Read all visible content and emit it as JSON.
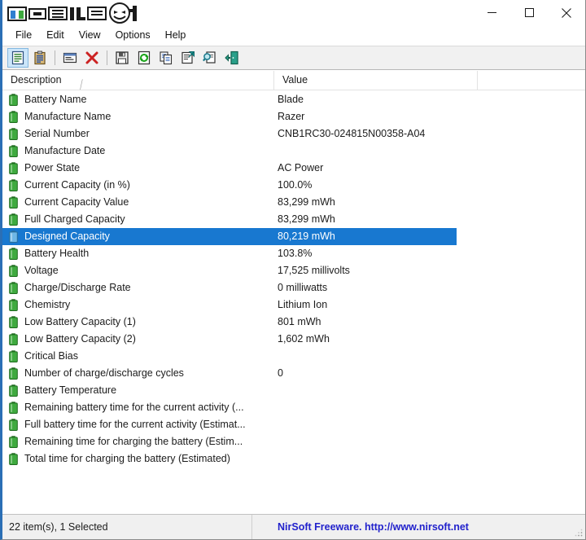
{
  "window": {
    "logo_alt": "mobile01",
    "controls": [
      {
        "name": "minimize",
        "glyph": "—"
      },
      {
        "name": "maximize",
        "glyph": "□"
      },
      {
        "name": "close",
        "glyph": "✕"
      }
    ]
  },
  "menu": {
    "items": [
      {
        "label": "File"
      },
      {
        "label": "Edit"
      },
      {
        "label": "View"
      },
      {
        "label": "Options"
      },
      {
        "label": "Help"
      }
    ]
  },
  "toolbar": {
    "buttons": [
      {
        "icon": "properties-icon",
        "pressed": true
      },
      {
        "icon": "clipboard-icon",
        "pressed": false
      },
      {
        "sep": true
      },
      {
        "icon": "html-report-icon",
        "pressed": false
      },
      {
        "icon": "delete-red-x-icon",
        "pressed": false
      },
      {
        "sep": true
      },
      {
        "icon": "save-floppy-icon",
        "pressed": false
      },
      {
        "icon": "refresh-icon",
        "pressed": false
      },
      {
        "icon": "copy-icon",
        "pressed": false
      },
      {
        "icon": "properties-page-icon",
        "pressed": false
      },
      {
        "icon": "find-icon",
        "pressed": false
      },
      {
        "icon": "exit-icon",
        "pressed": false
      }
    ]
  },
  "list": {
    "columns": [
      {
        "key": "description",
        "label": "Description",
        "sorted": true,
        "sort_glyph": "╱"
      },
      {
        "key": "value",
        "label": "Value",
        "sorted": false
      }
    ],
    "row_icon": "battery-icon",
    "rows": [
      {
        "description": "Battery Name",
        "value": "Blade",
        "selected": false
      },
      {
        "description": "Manufacture Name",
        "value": "Razer",
        "selected": false
      },
      {
        "description": "Serial Number",
        "value": "CNB1RC30-024815N00358-A04",
        "selected": false
      },
      {
        "description": "Manufacture Date",
        "value": "",
        "selected": false
      },
      {
        "description": "Power State",
        "value": "AC Power",
        "selected": false
      },
      {
        "description": "Current Capacity (in %)",
        "value": "100.0%",
        "selected": false
      },
      {
        "description": "Current Capacity Value",
        "value": "83,299 mWh",
        "selected": false
      },
      {
        "description": "Full Charged Capacity",
        "value": "83,299 mWh",
        "selected": false
      },
      {
        "description": "Designed Capacity",
        "value": "80,219 mWh",
        "selected": true
      },
      {
        "description": "Battery Health",
        "value": "103.8%",
        "selected": false
      },
      {
        "description": "Voltage",
        "value": "17,525 millivolts",
        "selected": false
      },
      {
        "description": "Charge/Discharge Rate",
        "value": "0 milliwatts",
        "selected": false
      },
      {
        "description": "Chemistry",
        "value": "Lithium Ion",
        "selected": false
      },
      {
        "description": "Low Battery Capacity (1)",
        "value": "801 mWh",
        "selected": false
      },
      {
        "description": "Low Battery Capacity (2)",
        "value": "1,602 mWh",
        "selected": false
      },
      {
        "description": "Critical Bias",
        "value": "",
        "selected": false
      },
      {
        "description": "Number of charge/discharge cycles",
        "value": "0",
        "selected": false
      },
      {
        "description": "Battery Temperature",
        "value": "",
        "selected": false
      },
      {
        "description": "Remaining battery time for the current activity (...",
        "value": "",
        "selected": false
      },
      {
        "description": "Full battery time for the current activity (Estimat...",
        "value": "",
        "selected": false
      },
      {
        "description": "Remaining time for charging the battery (Estim...",
        "value": "",
        "selected": false
      },
      {
        "description": "Total  time for charging the battery (Estimated)",
        "value": "",
        "selected": false
      }
    ]
  },
  "status": {
    "items_text": "22 item(s), 1 Selected",
    "credit_text": "NirSoft Freeware.  http://www.nirsoft.net"
  },
  "colors": {
    "selection_blue": "#1878d0",
    "credit_blue": "#2222cc",
    "battery_green": "#3faa3f",
    "battery_selected": "#6fb7e6",
    "toolbar_bg": "#f1f1f1",
    "status_bg": "#f0f0f0"
  }
}
